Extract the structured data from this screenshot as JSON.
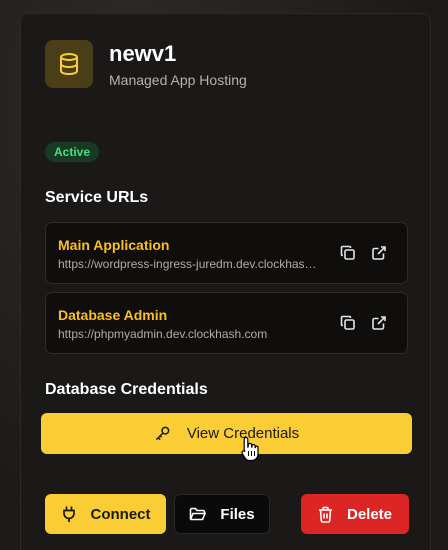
{
  "app": {
    "name": "newv1",
    "subtitle": "Managed App Hosting"
  },
  "status": {
    "label": "Active",
    "color": "#4ade80"
  },
  "service_urls": {
    "title": "Service URLs",
    "items": [
      {
        "label": "Main Application",
        "url": "https://wordpress-ingress-juredm.dev.clockhash.com"
      },
      {
        "label": "Database Admin",
        "url": "https://phpmyadmin.dev.clockhash.com"
      }
    ]
  },
  "database": {
    "title": "Database Credentials",
    "view_label": "View Credentials"
  },
  "actions": {
    "connect_label": "Connect",
    "files_label": "Files",
    "delete_label": "Delete"
  },
  "icons": [
    "database-icon",
    "copy-icon",
    "external-link-icon",
    "key-icon",
    "plug-icon",
    "folder-icon",
    "trash-icon",
    "hand-pointer-icon"
  ],
  "colors": {
    "accent": "#fbcd35",
    "url_label": "#fbbf24",
    "danger": "#dc2626"
  }
}
